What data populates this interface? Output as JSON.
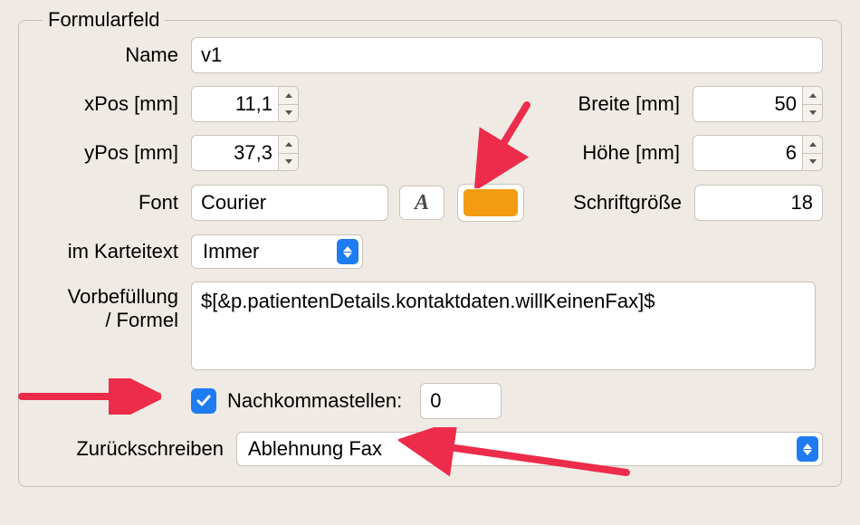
{
  "groupbox_title": "Formularfeld",
  "labels": {
    "name": "Name",
    "xpos": "xPos [mm]",
    "ypos": "yPos [mm]",
    "breite": "Breite [mm]",
    "hoehe": "Höhe [mm]",
    "font": "Font",
    "schriftgroesse": "Schriftgröße",
    "im_karteitext": "im Karteitext",
    "vorbefuellung_line1": "Vorbefüllung",
    "vorbefuellung_line2": "/ Formel",
    "nachkommastellen": "Nachkommastellen:",
    "zurueckschreiben": "Zurückschreiben"
  },
  "values": {
    "name": "v1",
    "xpos": "11,1",
    "ypos": "37,3",
    "breite": "50",
    "hoehe": "6",
    "font": "Courier",
    "schriftgroesse": "18",
    "im_karteitext": "Immer",
    "vorbefuellung": "$[&p.patientenDetails.kontaktdaten.willKeinenFax]$",
    "nachkommastellen_checked": true,
    "nachkommastellen_value": "0",
    "zurueckschreiben": "Ablehnung Fax"
  },
  "colors": {
    "swatch": "#f39c12",
    "accent": "#1e7cf2",
    "annotation_arrow": "#ec2c4a"
  }
}
